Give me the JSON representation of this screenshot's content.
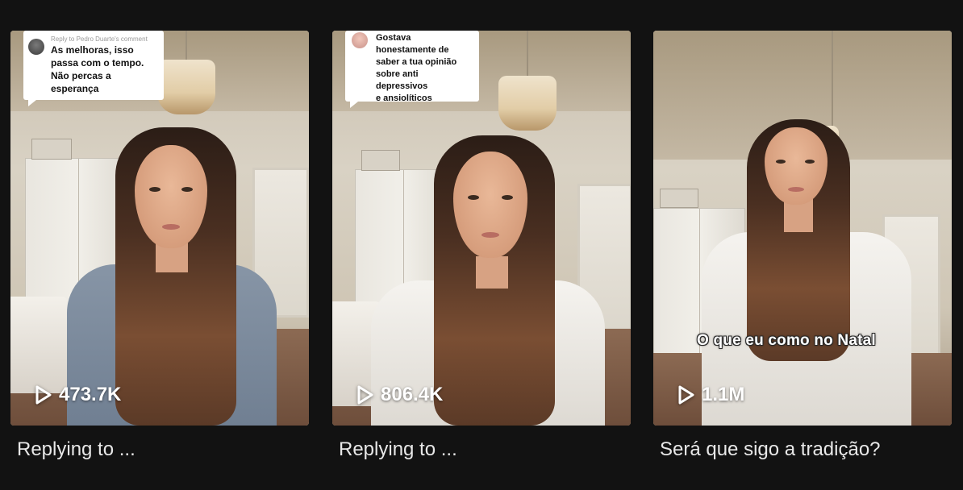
{
  "videos": [
    {
      "thumbnail": {
        "reply_meta": "Reply to Pedro Duarte's comment",
        "comment_text": "As melhoras, isso\npassa com o tempo.\nNão percas a\nesperança"
      },
      "views": "473.7K",
      "caption": "Replying to ..."
    },
    {
      "thumbnail": {
        "reply_meta": "",
        "comment_text": "Gostava\nhonestamente de\nsaber a tua opinião\nsobre anti depressivos\ne ansiolíticos"
      },
      "views": "806.4K",
      "caption": "Replying to ..."
    },
    {
      "thumbnail": {
        "overlay_text": "O que eu como no Natal"
      },
      "views": "1.1M",
      "caption": "Será que sigo a tradição?"
    }
  ],
  "icons": {
    "views": "play-icon",
    "comment_avatar": "avatar"
  },
  "colors": {
    "background": "#121212",
    "caption_text": "#e8e8e8",
    "overlay_text": "#ffffff"
  }
}
